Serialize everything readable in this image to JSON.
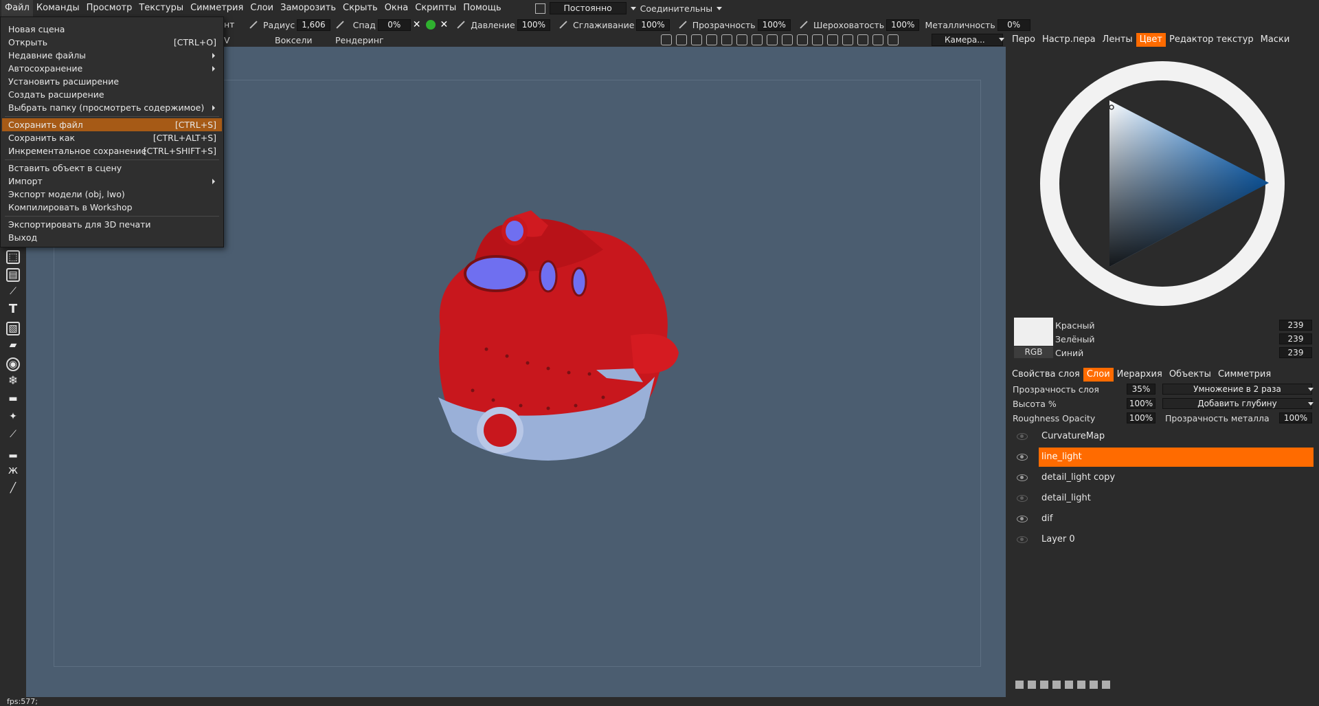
{
  "menubar": {
    "items": [
      "Файл",
      "Команды",
      "Просмотр",
      "Текстуры",
      "Симметрия",
      "Слои",
      "Заморозить",
      "Скрыть",
      "Окна",
      "Скрипты",
      "Помощь"
    ],
    "mode": "Постоянно",
    "connector": "Соединительны"
  },
  "toolbar": {
    "radius_label": "Радиус",
    "radius_value": "1,606",
    "falloff_label": "Спад",
    "falloff_value": "0%",
    "pressure_label": "Давление",
    "pressure_value": "100%",
    "smoothing_label": "Сглаживание",
    "smoothing_value": "100%",
    "opacity_label": "Прозрачность",
    "opacity_value": "100%",
    "roughness_label": "Шероховатость",
    "roughness_value": "100%",
    "metalness_label": "Металличность",
    "metalness_value": "0%",
    "green_dot_color": "#2fb12f"
  },
  "subbar": {
    "fragment_left": "нт",
    "fragment_uv": "V",
    "voxels": "Воксели",
    "render": "Рендеринг",
    "camera": "Камера..."
  },
  "file_menu": {
    "items": [
      {
        "label": "Новая сцена",
        "shortcut": ""
      },
      {
        "label": "Открыть",
        "shortcut": "[CTRL+O]"
      },
      {
        "label": "Недавние файлы",
        "shortcut": ""
      },
      {
        "label": "Автосохранение",
        "shortcut": ""
      },
      {
        "label": "Установить расширение",
        "shortcut": ""
      },
      {
        "label": "Создать расширение",
        "shortcut": ""
      },
      {
        "label": "Выбрать папку (просмотреть содержимое)",
        "shortcut": ""
      },
      {
        "label": "Сохранить файл",
        "shortcut": "[CTRL+S]"
      },
      {
        "label": "Сохранить как",
        "shortcut": "[CTRL+ALT+S]"
      },
      {
        "label": "Инкрементальное сохранение",
        "shortcut": "[CTRL+SHIFT+S]"
      },
      {
        "label": "Вставить объект в сцену",
        "shortcut": ""
      },
      {
        "label": "Импорт",
        "shortcut": ""
      },
      {
        "label": "Экспорт модели (obj, lwo)",
        "shortcut": ""
      },
      {
        "label": "Компилировать в Workshop",
        "shortcut": ""
      },
      {
        "label": "Экспортировать для 3D печати",
        "shortcut": ""
      },
      {
        "label": "Выход",
        "shortcut": ""
      }
    ],
    "highlight_color": "#a65a16"
  },
  "right_tabs": [
    "Перо",
    "Настр.пера",
    "Ленты",
    "Цвет",
    "Редактор текстур",
    "Маски"
  ],
  "color": {
    "swatch": "#efefef",
    "mode": "RGB",
    "red_label": "Красный",
    "red": "239",
    "green_label": "Зелёный",
    "green": "239",
    "blue_label": "Синий",
    "blue": "239",
    "accent": "#1e8fff"
  },
  "layer_tabs": [
    "Свойства слоя",
    "Слои",
    "Иерархия",
    "Объекты",
    "Симметрия"
  ],
  "layer_props": {
    "opacity_label": "Прозрачность слоя",
    "opacity": "35%",
    "blend": "Умножение в 2 раза",
    "height_label": "Высота %",
    "height": "100%",
    "depth": "Добавить глубину",
    "rough_label": "Roughness Opacity",
    "rough": "100%",
    "metal_label": "Прозрачность металла",
    "metal": "100%"
  },
  "layers": [
    "CurvatureMap",
    "line_light",
    "detail_light copy",
    "detail_light",
    "dif",
    "Layer 0"
  ],
  "selected_layer": "line_light",
  "accent_color": "#ff6b00",
  "status": "fps:577;"
}
